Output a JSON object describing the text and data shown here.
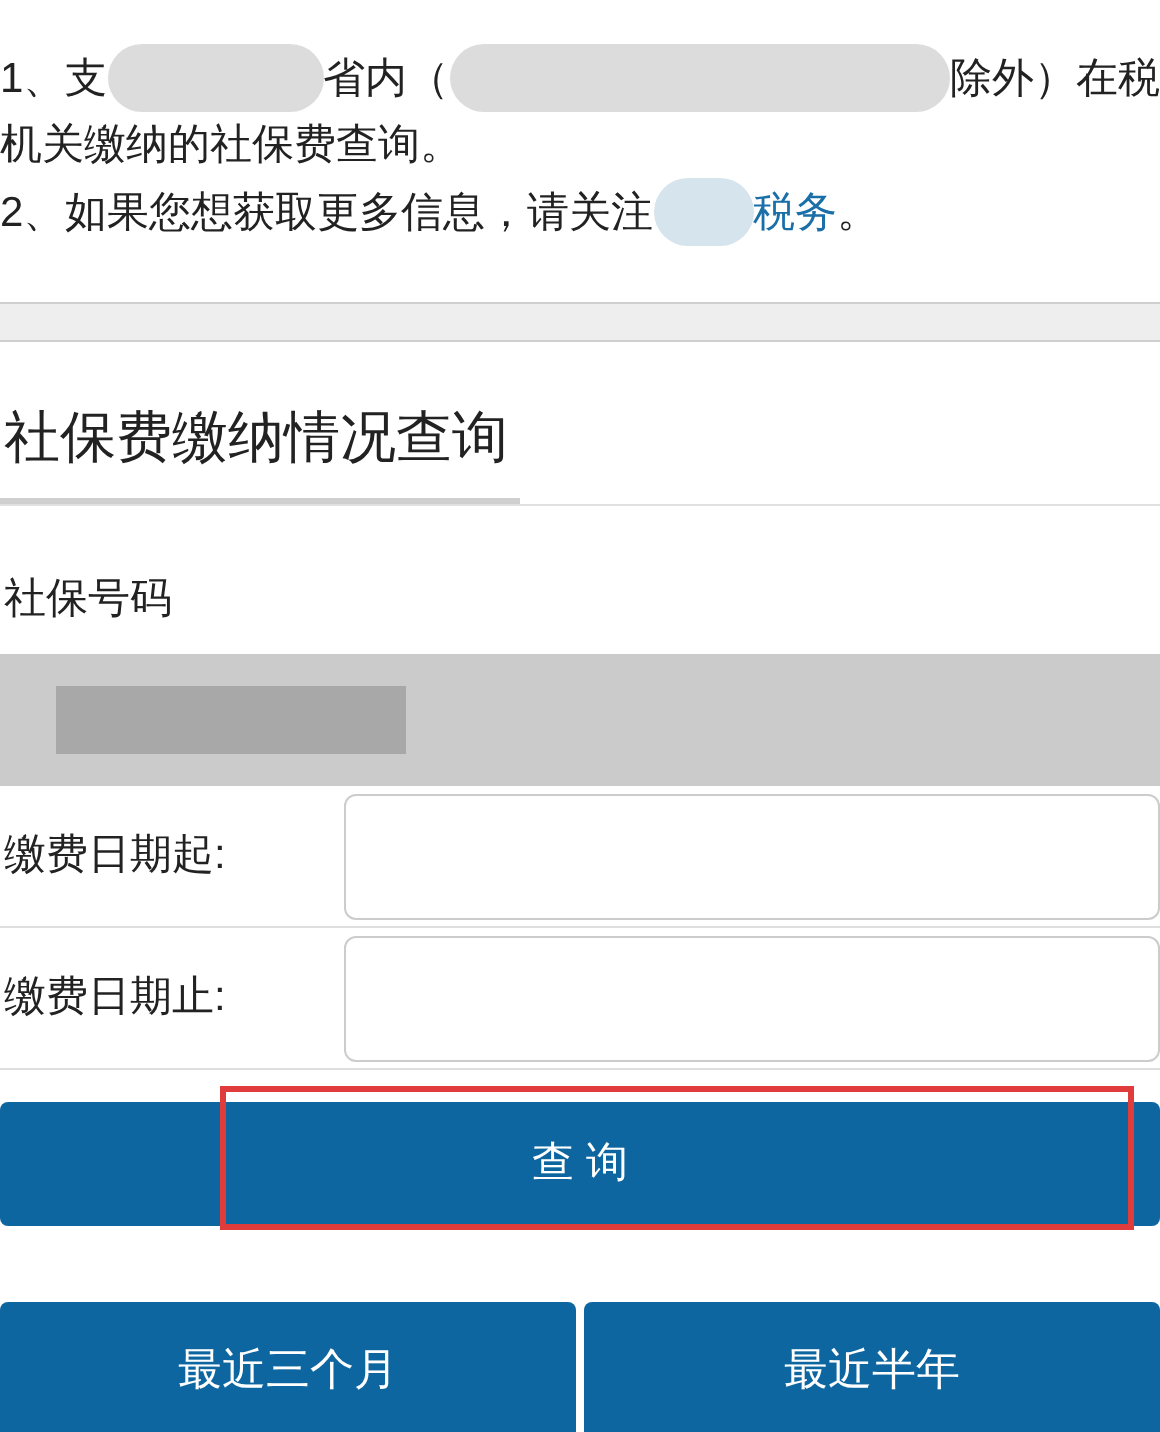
{
  "notice": {
    "line_1": [
      "1、支",
      "省内（",
      "除外）在税"
    ],
    "line_2": "机关缴纳的社保费查询。",
    "line_3": {
      "prefix": "2、如果您想获取更多信息，请关注",
      "link": "税务",
      "suffix": "。"
    }
  },
  "section_title": "社保费缴纳情况查询",
  "form": {
    "number_label": "社保号码",
    "date_fields": [
      {
        "label": "缴费日期起:"
      },
      {
        "label": "缴费日期止:"
      }
    ],
    "query_button": "查 询",
    "highlighted": true,
    "quick_buttons": [
      "最近三个月",
      "最近半年"
    ]
  }
}
